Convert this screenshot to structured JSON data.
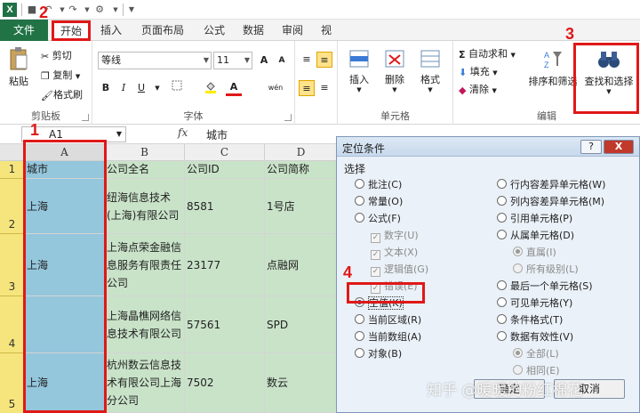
{
  "quick_access": {
    "app_icon": "X"
  },
  "tabs": [
    "文件",
    "开始",
    "插入",
    "页面布局",
    "公式",
    "数据",
    "审阅",
    "视"
  ],
  "clipboard": {
    "paste": "粘贴",
    "cut": "剪切",
    "copy": "复制",
    "format_painter": "格式刷",
    "label": "剪贴板"
  },
  "font": {
    "name": "等线",
    "size": "11",
    "grow": "A",
    "shrink": "A",
    "bold": "B",
    "italic": "I",
    "underline": "U",
    "font_color": "A",
    "phonetic": "wén",
    "label": "字体"
  },
  "cells_group": {
    "insert": "插入",
    "delete": "删除",
    "format": "格式",
    "label": "单元格"
  },
  "editing": {
    "autosum": "自动求和",
    "fill": "填充",
    "clear": "清除",
    "sort": "排序和筛选",
    "find": "查找和选择",
    "label": "编辑"
  },
  "formula_bar": {
    "name_box": "A1",
    "fx": "fx",
    "value": "城市"
  },
  "grid": {
    "columns": [
      "A",
      "B",
      "C",
      "D"
    ],
    "rows": [
      {
        "num": "1",
        "cells": [
          "城市",
          "公司全名",
          "公司ID",
          "公司简称"
        ]
      },
      {
        "num": "2",
        "cells": [
          "上海",
          "纽海信息技术(上海)有限公司",
          "8581",
          "1号店"
        ]
      },
      {
        "num": "3",
        "cells": [
          "上海",
          "上海点荣金融信息服务有限责任公司",
          "23177",
          "点融网"
        ]
      },
      {
        "num": "4",
        "cells": [
          "",
          "上海晶樵网络信息技术有限公司",
          "57561",
          "SPD"
        ]
      },
      {
        "num": "5",
        "cells": [
          "上海",
          "杭州数云信息技术有限公司上海分公司",
          "7502",
          "数云"
        ]
      }
    ]
  },
  "dialog": {
    "title": "定位条件",
    "help": "?",
    "close": "X",
    "section": "选择",
    "left_options": [
      "批注(C)",
      "常量(O)",
      "公式(F)",
      "数字(U)",
      "文本(X)",
      "逻辑值(G)",
      "错误(E)",
      "空值(K)",
      "当前区域(R)",
      "当前数组(A)",
      "对象(B)"
    ],
    "right_options": [
      "行内容差异单元格(W)",
      "列内容差异单元格(M)",
      "引用单元格(P)",
      "从属单元格(D)",
      "直属(I)",
      "所有级别(L)",
      "最后一个单元格(S)",
      "可见单元格(Y)",
      "条件格式(T)",
      "数据有效性(V)",
      "全部(L)",
      "相同(E)"
    ],
    "ok": "确定",
    "cancel": "取消"
  },
  "annotations": [
    "1",
    "2",
    "3",
    "4"
  ],
  "watermark": "知乎 @暖暖的粉红棉花",
  "colors": {
    "file_tab": "#217346",
    "highlight_red": "#e01818",
    "col_a_fill": "#94c6dc",
    "cell_fill": "#c9e3c9",
    "row_header": "#f5e57c"
  }
}
